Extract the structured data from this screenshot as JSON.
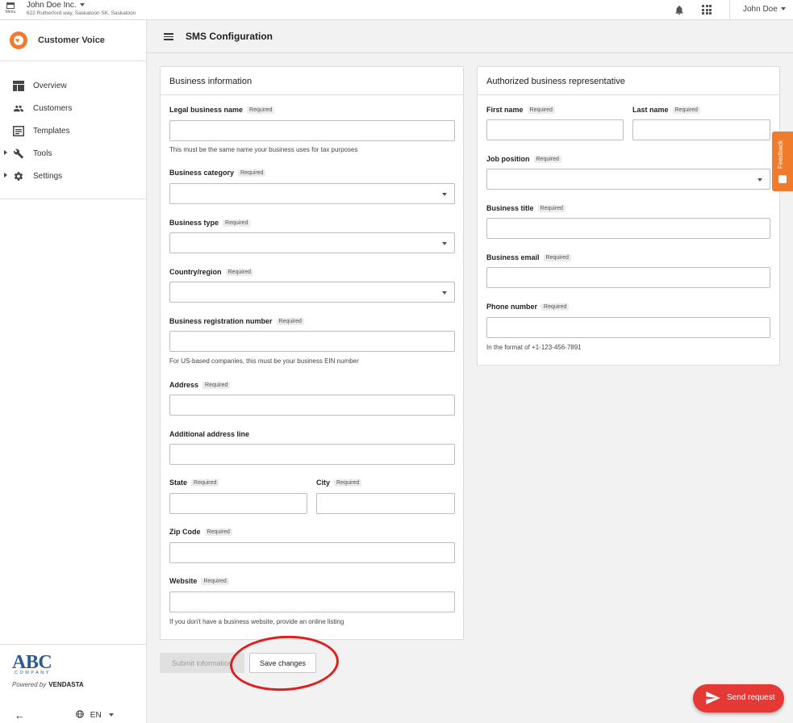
{
  "topbar": {
    "menu_label": "Menu",
    "business_name": "John Doe Inc.",
    "business_address": "622 Rutherford way, Saskatoon SK, Saskatoon",
    "user_name": "John Doe"
  },
  "sidebar": {
    "app_name": "Customer Voice",
    "items": [
      {
        "label": "Overview",
        "icon": "overview-icon"
      },
      {
        "label": "Customers",
        "icon": "customers-icon"
      },
      {
        "label": "Templates",
        "icon": "templates-icon"
      },
      {
        "label": "Tools",
        "icon": "tools-icon"
      },
      {
        "label": "Settings",
        "icon": "settings-icon"
      }
    ],
    "footer": {
      "logo_text": "ABC",
      "logo_sub": "COMPANY",
      "powered_by": "Powered by",
      "vendor": "VENDASTA",
      "language": "EN"
    }
  },
  "header": {
    "title": "SMS Configuration"
  },
  "required_badge": "Required",
  "business_info": {
    "title": "Business information",
    "legal_name_label": "Legal business name",
    "legal_name_hint": "This must be the same name your business uses for tax purposes",
    "category_label": "Business category",
    "type_label": "Business type",
    "country_label": "Country/region",
    "registration_label": "Business registration number",
    "registration_hint": "For US-based companies, this must be your business EIN number",
    "address_label": "Address",
    "address2_label": "Additional address line",
    "state_label": "State",
    "city_label": "City",
    "zip_label": "Zip Code",
    "website_label": "Website",
    "website_hint": "If you don't have a business website, provide an online listing"
  },
  "representative": {
    "title": "Authorized business representative",
    "first_name_label": "First name",
    "last_name_label": "Last name",
    "job_position_label": "Job position",
    "business_title_label": "Business title",
    "business_email_label": "Business email",
    "phone_label": "Phone number",
    "phone_hint": "In the format of +1-123-456-7891"
  },
  "actions": {
    "submit_label": "Submit information",
    "save_label": "Save changes",
    "send_label": "Send request",
    "feedback_label": "Feedback"
  }
}
